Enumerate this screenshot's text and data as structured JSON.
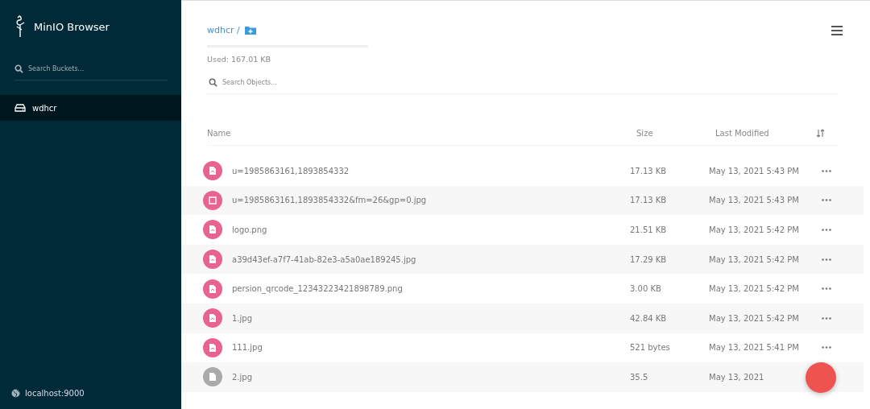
{
  "sidebar": {
    "app_title": "MinIO Browser",
    "search": {
      "placeholder": "Search Buckets..."
    },
    "buckets": [
      {
        "name": "wdhcr",
        "selected": true
      }
    ],
    "host": "localhost:9000"
  },
  "main": {
    "breadcrumb": "wdhcr /",
    "usage": {
      "label": "Used: 167.01 KB"
    },
    "search": {
      "placeholder": "Search Objects..."
    },
    "table": {
      "columns": [
        "Name",
        "Size",
        "Last Modified"
      ],
      "rows": [
        {
          "kind": "image",
          "name": "u=1985863161,1893854332",
          "size": "17.13 KB",
          "modified": "May 13, 2021 5:43 PM"
        },
        {
          "kind": "blank",
          "name": "u=1985863161,1893854332&fm=26&gp=0.jpg",
          "size": "17.13 KB",
          "modified": "May 13, 2021 5:43 PM"
        },
        {
          "kind": "image",
          "name": "logo.png",
          "size": "21.51 KB",
          "modified": "May 13, 2021 5:42 PM"
        },
        {
          "kind": "image",
          "name": "a39d43ef-a7f7-41ab-82e3-a5a0ae189245.jpg",
          "size": "17.29 KB",
          "modified": "May 13, 2021 5:42 PM"
        },
        {
          "kind": "image",
          "name": "persion_qrcode_12343223421898789.png",
          "size": "3.00 KB",
          "modified": "May 13, 2021 5:42 PM"
        },
        {
          "kind": "image",
          "name": "1.jpg",
          "size": "42.84 KB",
          "modified": "May 13, 2021 5:42 PM"
        },
        {
          "kind": "image",
          "name": "111.jpg",
          "size": "521 bytes",
          "modified": "May 13, 2021 5:41 PM"
        },
        {
          "kind": "file",
          "name": "2.jpg",
          "size": "35.5",
          "modified": "May 13, 2021"
        }
      ]
    }
  }
}
